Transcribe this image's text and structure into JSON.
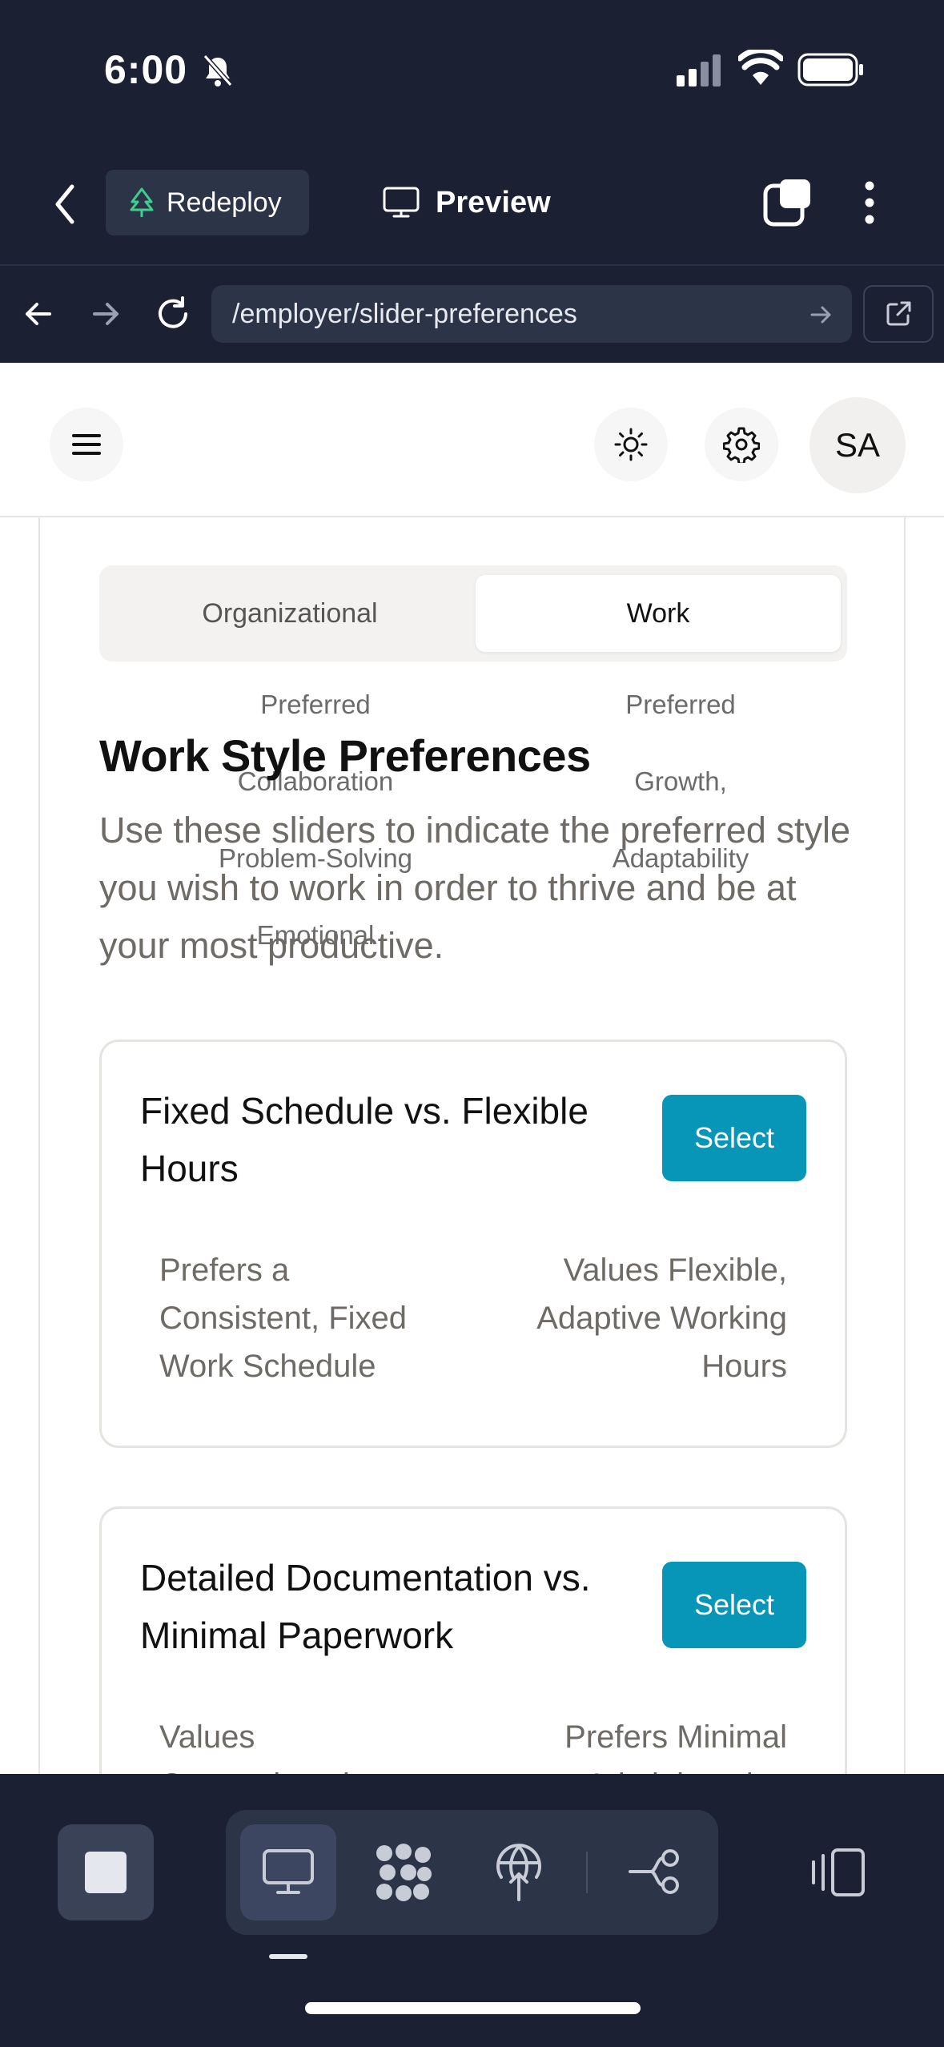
{
  "status_bar": {
    "time": "6:00",
    "icons": [
      "bell-slash-icon",
      "signal-icon",
      "wifi-icon",
      "battery-icon"
    ]
  },
  "app_bar": {
    "redeploy_label": "Redeploy",
    "preview_label": "Preview"
  },
  "url_bar": {
    "url": "/employer/slider-preferences"
  },
  "header": {
    "avatar_initials": "SA"
  },
  "tabs": {
    "left": "Organizational",
    "right": "Work",
    "selected": "Work"
  },
  "ghost_text": {
    "left": [
      "Preferred",
      "Collaboration",
      "Problem-Solving",
      "Emotional"
    ],
    "right": [
      "Preferred",
      "Growth,",
      "Adaptability"
    ]
  },
  "main": {
    "title": "Work Style Preferences",
    "subtitle": "Use these sliders to indicate the preferred style you wish to work in order to thrive and be at your most productive."
  },
  "cards": [
    {
      "title": "Fixed Schedule vs. Flexible Hours",
      "button": "Select",
      "left": "Prefers a Consistent, Fixed Work Schedule",
      "right": "Values Flexible, Adaptive Working Hours"
    },
    {
      "title": "Detailed Documentation vs. Minimal Paperwork",
      "button": "Select",
      "left": "Values Comprehensive",
      "right": "Prefers Minimal Administrative"
    }
  ],
  "colors": {
    "chrome_bg": "#1b2133",
    "accent": "#0796b8",
    "redeploy_icon": "#3ecf8e"
  }
}
